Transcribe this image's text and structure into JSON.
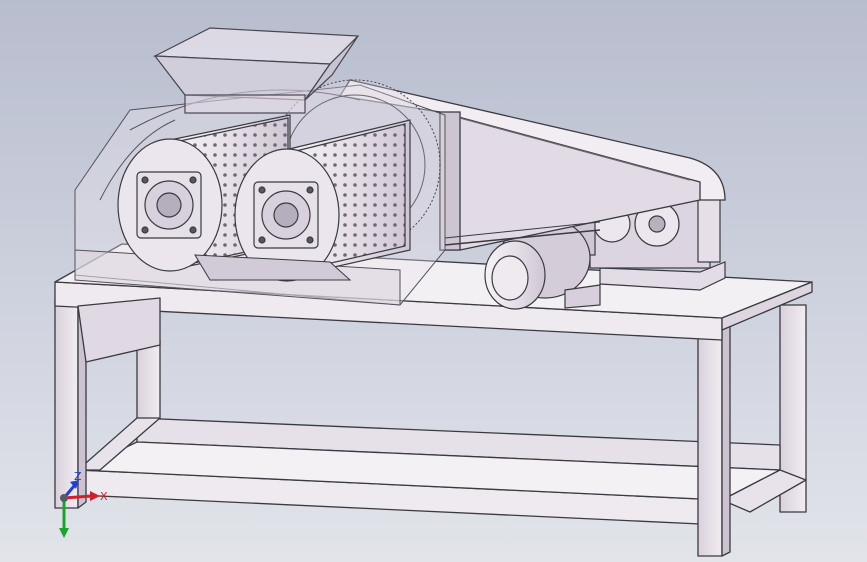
{
  "viewport": {
    "background_top": "#b8bdce",
    "background_bottom": "#e2e4ea"
  },
  "triad": {
    "x_label": "X",
    "y_label": "Y",
    "z_label": "Z",
    "x_color": "#d0202a",
    "y_color": "#20a030",
    "z_color": "#2040d0"
  },
  "model": {
    "name_icon": "double-roller-crusher-assembly",
    "frame_color": "#e4dde6",
    "edge_color": "#3a3a40",
    "accent_color": "#f2eef2"
  }
}
